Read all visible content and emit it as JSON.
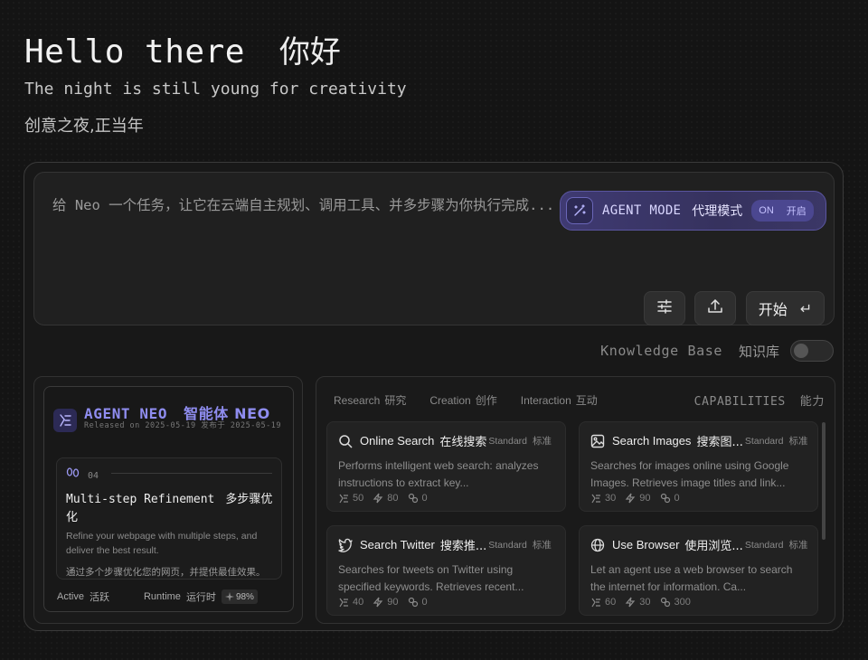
{
  "greeting": {
    "en": "Hello there",
    "zh": "你好"
  },
  "subtitle": {
    "en": "The night is still young for creativity",
    "zh": "创意之夜,正当年"
  },
  "prompt": {
    "placeholder": "给 Neo 一个任务，让它在云端自主规划、调用工具、并多步骤为你执行完成...",
    "agent_mode": {
      "label": "AGENT MODE",
      "label_zh": "代理模式",
      "state": "ON",
      "state_zh": "开启"
    },
    "start_label": "开始",
    "start_shortcut": "↵"
  },
  "knowledge_base": {
    "label": "Knowledge Base",
    "label_zh": "知识库",
    "enabled": false
  },
  "agent_card": {
    "name": "AGENT NEO",
    "name_zh": "智能体 NEO",
    "released": "Released on 2025-05-19  发布于 2025-05-19",
    "step": {
      "number": "04",
      "title": "Multi-step Refinement",
      "title_zh": "多步骤优化",
      "desc": "Refine your webpage with multiple steps, and deliver the best result.",
      "desc_zh": "通过多个步骤优化您的网页，并提供最佳效果。"
    },
    "status": {
      "label": "Active",
      "label_zh": "活跃"
    },
    "runtime": {
      "label": "Runtime",
      "label_zh": "运行时",
      "value": "98%"
    }
  },
  "capabilities": {
    "tabs": [
      {
        "en": "Research",
        "zh": "研究"
      },
      {
        "en": "Creation",
        "zh": "创作"
      },
      {
        "en": "Interaction",
        "zh": "互动"
      }
    ],
    "title": "CAPABILITIES",
    "title_zh": "能力",
    "tools": [
      {
        "icon": "search-icon",
        "name": "Online Search",
        "name_zh": "在线搜索",
        "tier": "Standard",
        "tier_zh": "标准",
        "desc": "Performs intelligent web search: analyzes instructions to extract key...",
        "stats": [
          "50",
          "80",
          "0"
        ]
      },
      {
        "icon": "image-icon",
        "name": "Search Images",
        "name_zh": "搜索图...",
        "tier": "Standard",
        "tier_zh": "标准",
        "desc": "Searches for images online using Google Images. Retrieves image titles and link...",
        "stats": [
          "30",
          "90",
          "0"
        ]
      },
      {
        "icon": "twitter-icon",
        "name": "Search Twitter",
        "name_zh": "搜索推...",
        "tier": "Standard",
        "tier_zh": "标准",
        "desc": "Searches for tweets on Twitter using specified keywords. Retrieves recent...",
        "stats": [
          "40",
          "90",
          "0"
        ]
      },
      {
        "icon": "globe-icon",
        "name": "Use Browser",
        "name_zh": "使用浏览...",
        "tier": "Standard",
        "tier_zh": "标准",
        "desc": "Let an agent use a web browser to search the internet for information. Ca...",
        "stats": [
          "60",
          "30",
          "300"
        ]
      }
    ]
  }
}
